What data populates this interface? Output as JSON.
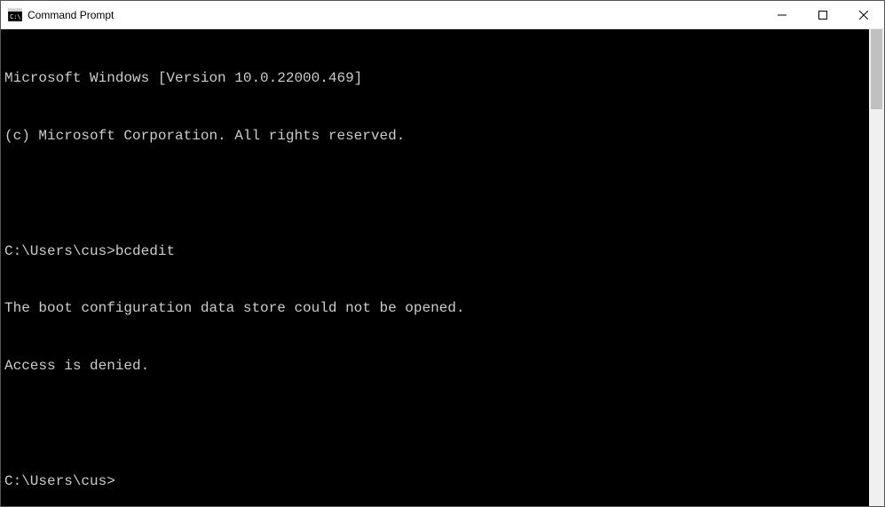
{
  "window": {
    "title": "Command Prompt"
  },
  "terminal": {
    "header_line1": "Microsoft Windows [Version 10.0.22000.469]",
    "header_line2": "(c) Microsoft Corporation. All rights reserved.",
    "block1": {
      "prompt": "C:\\Users\\cus>",
      "command": "bcdedit",
      "output_line1": "The boot configuration data store could not be opened.",
      "output_line2": "Access is denied."
    },
    "current_prompt": "C:\\Users\\cus>"
  }
}
